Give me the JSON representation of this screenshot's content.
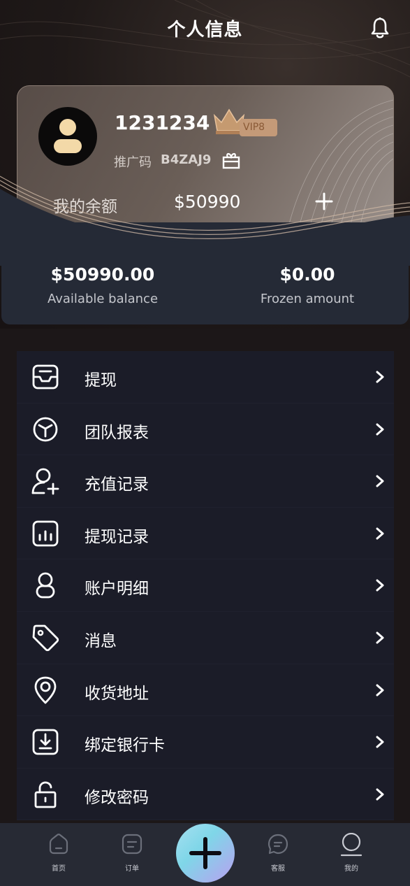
{
  "header": {
    "title": "个人信息",
    "bell_icon": "bell-icon"
  },
  "profile": {
    "username": "1231234",
    "vip_level": "VIP8",
    "promo_label": "推广码",
    "promo_code": "B4ZAJ9",
    "balance_label": "我的余额",
    "balance_value": "$50990"
  },
  "balances": {
    "available_amount": "$50990.00",
    "available_caption": "Available balance",
    "frozen_amount": "$0.00",
    "frozen_caption": "Frozen amount"
  },
  "menu": [
    {
      "label": "提现",
      "icon": "inbox-icon"
    },
    {
      "label": "团队报表",
      "icon": "cube-icon"
    },
    {
      "label": "充值记录",
      "icon": "add-user-icon"
    },
    {
      "label": "提现记录",
      "icon": "bar-chart-icon"
    },
    {
      "label": "账户明细",
      "icon": "user-icon"
    },
    {
      "label": "消息",
      "icon": "tag-icon"
    },
    {
      "label": "收货地址",
      "icon": "location-pin-icon"
    },
    {
      "label": "绑定银行卡",
      "icon": "download-box-icon"
    },
    {
      "label": "修改密码",
      "icon": "unlock-icon"
    }
  ],
  "tabs": [
    {
      "label": "首页",
      "icon": "home-icon"
    },
    {
      "label": "订单",
      "icon": "order-icon"
    },
    {
      "label": "",
      "icon": "plus-icon"
    },
    {
      "label": "客服",
      "icon": "chat-icon"
    },
    {
      "label": "我的",
      "icon": "profile-icon"
    }
  ],
  "colors": {
    "card_accent": "#c49a78",
    "panel": "#252a36",
    "menu_bg": "#1b1c28"
  }
}
